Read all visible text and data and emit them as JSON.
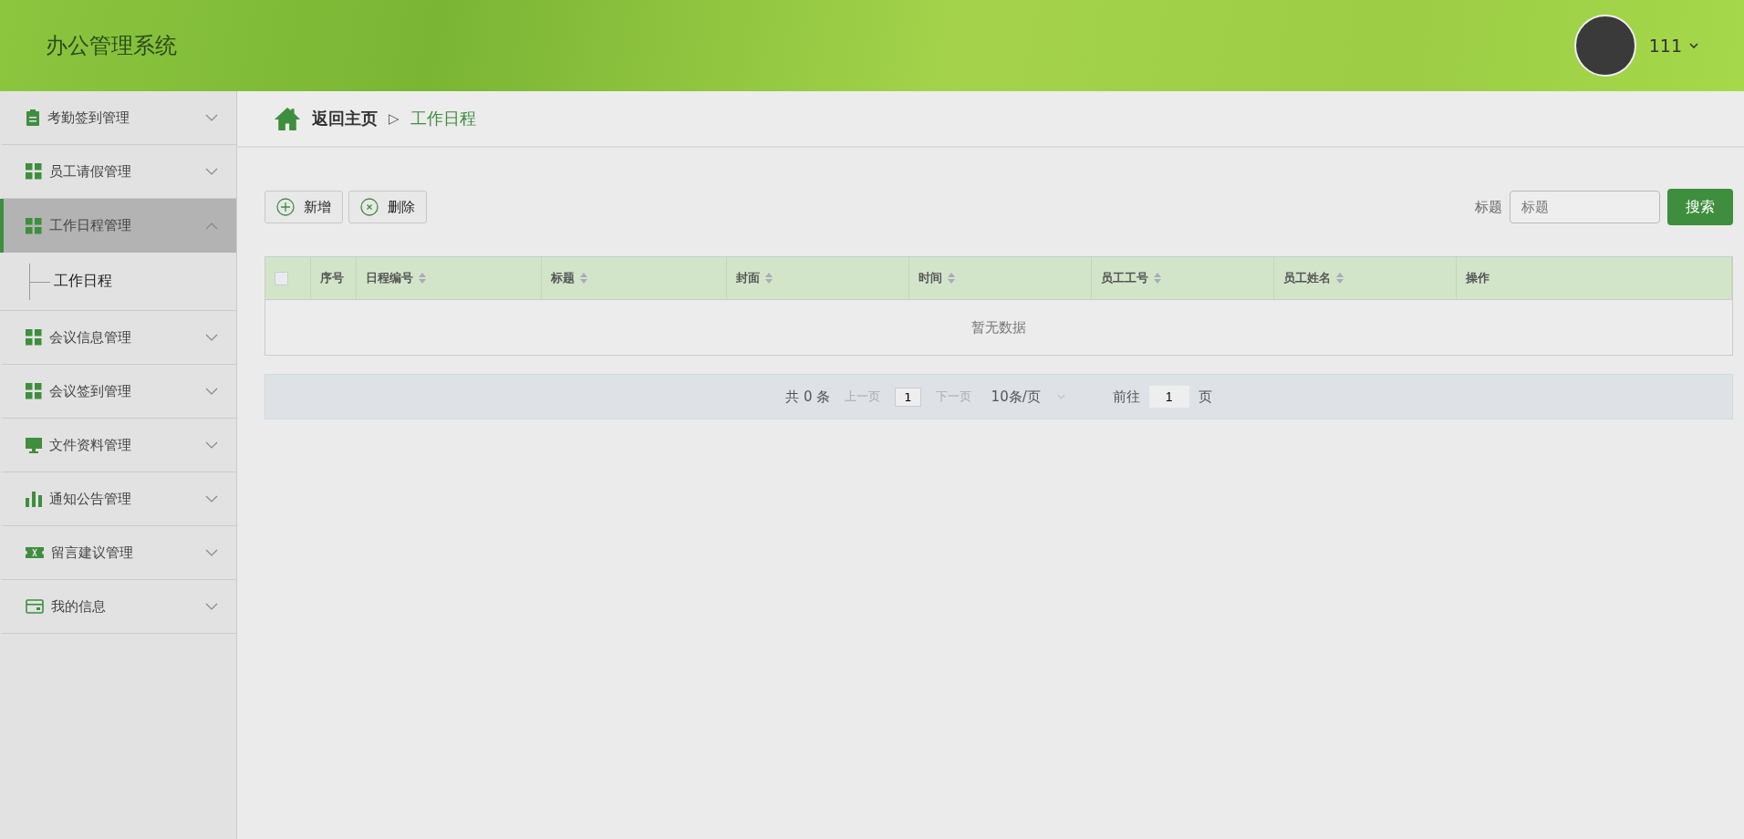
{
  "header": {
    "title": "办公管理系统",
    "user": {
      "name": "111"
    }
  },
  "sidebar": {
    "items": [
      {
        "label": "考勤签到管理",
        "expanded": false
      },
      {
        "label": "员工请假管理",
        "expanded": false
      },
      {
        "label": "工作日程管理",
        "expanded": true,
        "children": [
          {
            "label": "工作日程"
          }
        ]
      },
      {
        "label": "会议信息管理",
        "expanded": false
      },
      {
        "label": "会议签到管理",
        "expanded": false
      },
      {
        "label": "文件资料管理",
        "expanded": false
      },
      {
        "label": "通知公告管理",
        "expanded": false
      },
      {
        "label": "留言建议管理",
        "expanded": false
      },
      {
        "label": "我的信息",
        "expanded": false
      }
    ]
  },
  "breadcrumb": {
    "home": "返回主页",
    "separator": "▷",
    "current": "工作日程"
  },
  "toolbar": {
    "buttons": [
      {
        "kind": "add",
        "label": "新增"
      },
      {
        "kind": "delete",
        "label": "删除"
      }
    ],
    "search_label": "标题",
    "search": {
      "placeholder": "标题"
    },
    "search_button": "搜索"
  },
  "table": {
    "select_all": {
      "checked": false
    },
    "columns": [
      {
        "label": "序号",
        "sortable": false
      },
      {
        "label": "日程编号",
        "sortable": true
      },
      {
        "label": "标题",
        "sortable": true
      },
      {
        "label": "封面",
        "sortable": true
      },
      {
        "label": "时间",
        "sortable": true
      },
      {
        "label": "员工工号",
        "sortable": true
      },
      {
        "label": "员工姓名",
        "sortable": true
      },
      {
        "label": "操作",
        "sortable": false
      }
    ],
    "empty_text": "暂无数据"
  },
  "pagination": {
    "total": "共 0 条",
    "prev": "上一页",
    "page": "1",
    "next": "下一页",
    "page_size": "10条/页",
    "goto_label": "前往",
    "goto_value": "1",
    "goto_suffix": "页"
  }
}
